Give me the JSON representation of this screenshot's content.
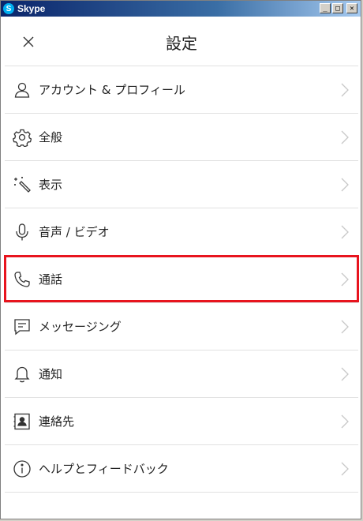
{
  "window": {
    "title": "Skype",
    "icon_letter": "S",
    "buttons": [
      "minimize",
      "maximize",
      "close"
    ]
  },
  "header": {
    "title": "設定",
    "close_icon": "close-icon"
  },
  "menu": [
    {
      "label": "アカウント & プロフィール",
      "icon": "person-icon"
    },
    {
      "label": "全般",
      "icon": "gear-icon"
    },
    {
      "label": "表示",
      "icon": "magic-wand-icon"
    },
    {
      "label": "音声 / ビデオ",
      "icon": "microphone-icon"
    },
    {
      "label": "通話",
      "icon": "phone-icon",
      "highlighted": true
    },
    {
      "label": "メッセージング",
      "icon": "message-icon"
    },
    {
      "label": "通知",
      "icon": "bell-icon"
    },
    {
      "label": "連絡先",
      "icon": "contacts-icon"
    },
    {
      "label": "ヘルプとフィードバック",
      "icon": "info-icon"
    }
  ],
  "colors": {
    "highlight": "#e8141e",
    "titlebar": "#0a246a",
    "divider": "#e1e1e1"
  }
}
